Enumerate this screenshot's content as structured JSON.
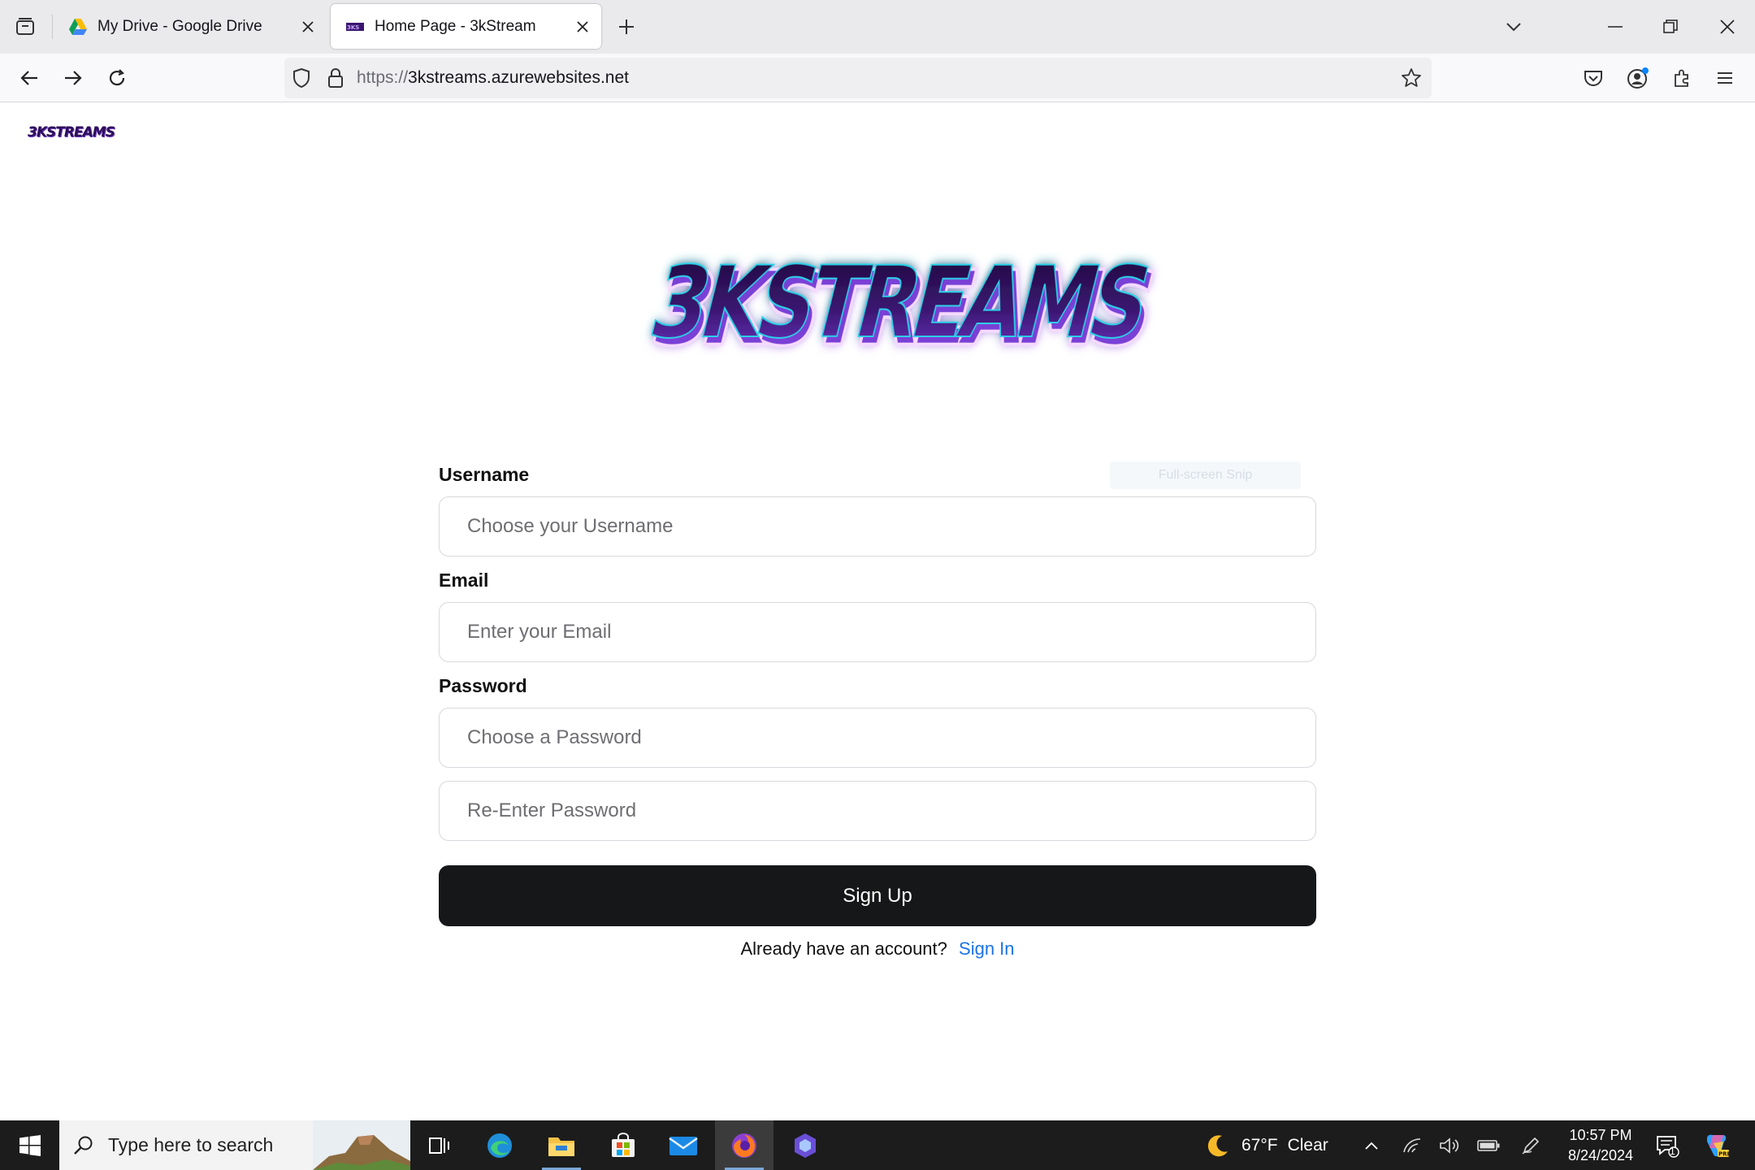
{
  "browser": {
    "tabs": [
      {
        "title": "My Drive - Google Drive",
        "active": false,
        "icon": "google-drive-icon"
      },
      {
        "title": "Home Page - 3kStream",
        "active": true,
        "icon": "3kstreams-favicon"
      }
    ],
    "url": {
      "scheme": "https://",
      "host": "3kstreams.azurewebsites.net"
    }
  },
  "page": {
    "small_logo": "3KSTREAMS",
    "big_logo": "3KSTREAMS",
    "form": {
      "username_label": "Username",
      "username_placeholder": "Choose your Username",
      "email_label": "Email",
      "email_placeholder": "Enter your Email",
      "password_label": "Password",
      "password_placeholder": "Choose a Password",
      "reenter_placeholder": "Re-Enter Password",
      "submit_label": "Sign Up"
    },
    "signin_prompt": "Already have an account?",
    "signin_link": "Sign In",
    "faint_badge": "Full-screen Snip"
  },
  "taskbar": {
    "search_placeholder": "Type here to search",
    "weather": {
      "temp": "67°F",
      "condition": "Clear"
    },
    "time": "10:57 PM",
    "date": "8/24/2024",
    "notification_count": "1"
  },
  "colors": {
    "accent_link": "#1a73e8",
    "button_bg": "#161718",
    "logo_purple": "#2e0f5a"
  }
}
